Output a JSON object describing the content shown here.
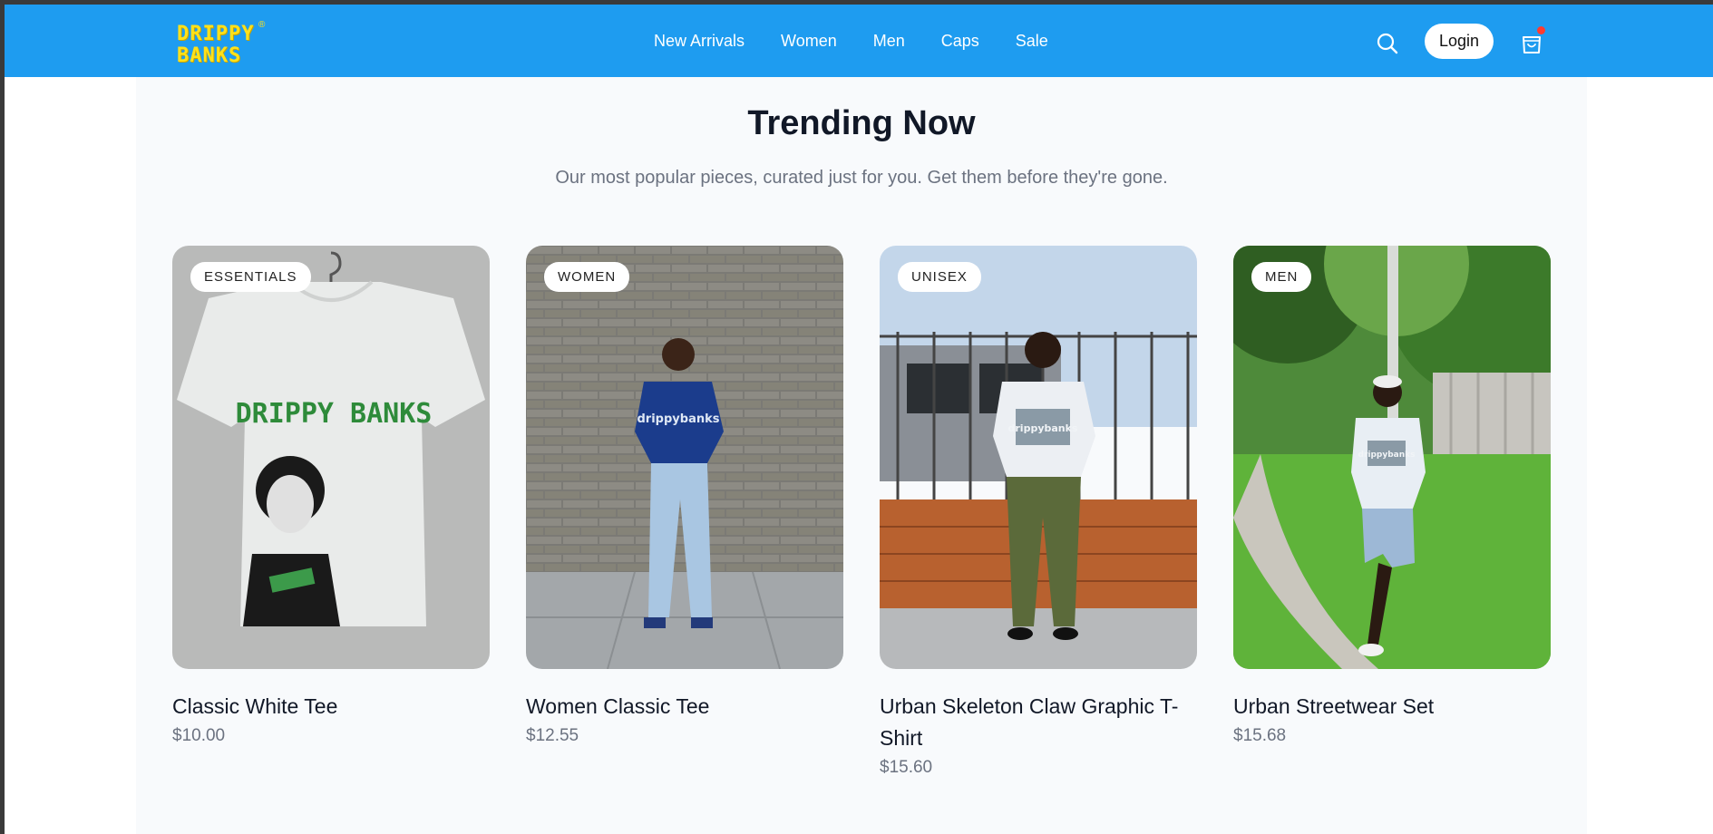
{
  "brand": {
    "logo_line1": "DRIPPY",
    "logo_line2": "BANKS",
    "logo_mark": "®",
    "logo_color": "#ffe11a",
    "nav_color": "#1e9cf0"
  },
  "nav": {
    "links": [
      "New Arrivals",
      "Women",
      "Men",
      "Caps",
      "Sale"
    ],
    "login_label": "Login",
    "search_icon": "search-icon",
    "cart_icon": "shopping-bag-icon"
  },
  "section": {
    "title": "Trending Now",
    "subtitle": "Our most popular pieces, curated just for you. Get them before they're gone."
  },
  "products": [
    {
      "badge": "ESSENTIALS",
      "name": "Classic White Tee",
      "price": "$10.00",
      "print_text": "DRIPPY BANKS"
    },
    {
      "badge": "WOMEN",
      "name": "Women Classic Tee",
      "price": "$12.55",
      "print_text": "drippybanks"
    },
    {
      "badge": "UNISEX",
      "name": "Urban Skeleton Claw Graphic T-Shirt",
      "price": "$15.60",
      "print_text": "drippybanks"
    },
    {
      "badge": "MEN",
      "name": "Urban Streetwear Set",
      "price": "$15.68",
      "print_text": "drippybanks"
    }
  ]
}
